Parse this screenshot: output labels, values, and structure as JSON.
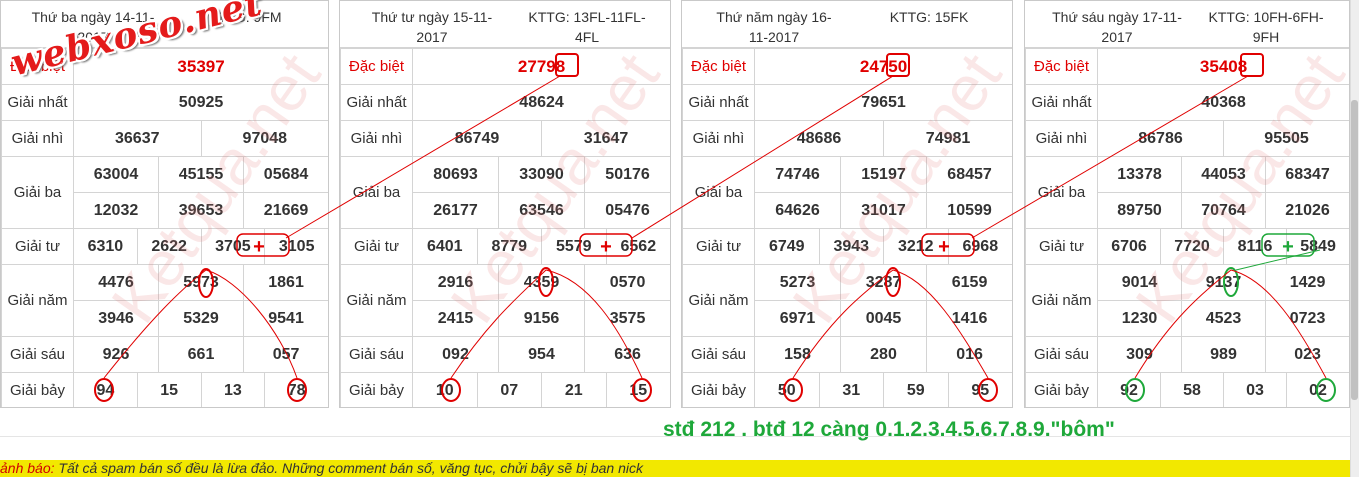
{
  "panels": [
    {
      "date_line1": "Thứ ba ngày 14-11-",
      "date_line2": "2017",
      "kttg_line1": "KTTG: 9FM",
      "kttg_line2": "",
      "dac_biet": "35397",
      "giai_nhat": "50925",
      "giai_nhi": [
        "36637",
        "97048"
      ],
      "giai_ba": [
        "63004",
        "45155",
        "05684",
        "12032",
        "39653",
        "21669"
      ],
      "giai_tu": [
        "6310",
        "2622",
        "3705",
        "3105"
      ],
      "giai_nam": [
        "4476",
        "5973",
        "1861",
        "3946",
        "5329",
        "9541"
      ],
      "giai_sau": [
        "926",
        "661",
        "057"
      ],
      "giai_bay": [
        "94",
        "15",
        "13",
        "78"
      ]
    },
    {
      "date_line1": "Thứ tư ngày 15-11-",
      "date_line2": "2017",
      "kttg_line1": "KTTG: 13FL-11FL-",
      "kttg_line2": "4FL",
      "dac_biet": "27798",
      "giai_nhat": "48624",
      "giai_nhi": [
        "86749",
        "31647"
      ],
      "giai_ba": [
        "80693",
        "33090",
        "50176",
        "26177",
        "63546",
        "05476"
      ],
      "giai_tu": [
        "6401",
        "8779",
        "5579",
        "6562"
      ],
      "giai_nam": [
        "2916",
        "4359",
        "0570",
        "2415",
        "9156",
        "3575"
      ],
      "giai_sau": [
        "092",
        "954",
        "636"
      ],
      "giai_bay": [
        "10",
        "07",
        "21",
        "15"
      ]
    },
    {
      "date_line1": "Thứ năm ngày 16-",
      "date_line2": "11-2017",
      "kttg_line1": "KTTG: 15FK",
      "kttg_line2": "",
      "dac_biet": "24750",
      "giai_nhat": "79651",
      "giai_nhi": [
        "48686",
        "74981"
      ],
      "giai_ba": [
        "74746",
        "15197",
        "68457",
        "64626",
        "31017",
        "10599"
      ],
      "giai_tu": [
        "6749",
        "3943",
        "3212",
        "6968"
      ],
      "giai_nam": [
        "5273",
        "3287",
        "6159",
        "6971",
        "0045",
        "1416"
      ],
      "giai_sau": [
        "158",
        "280",
        "016"
      ],
      "giai_bay": [
        "50",
        "31",
        "59",
        "95"
      ]
    },
    {
      "date_line1": "Thứ sáu ngày 17-11-",
      "date_line2": "2017",
      "kttg_line1": "KTTG: 10FH-6FH-",
      "kttg_line2": "9FH",
      "dac_biet": "35408",
      "giai_nhat": "40368",
      "giai_nhi": [
        "86786",
        "95505"
      ],
      "giai_ba": [
        "13378",
        "44053",
        "68347",
        "89750",
        "70764",
        "21026"
      ],
      "giai_tu": [
        "6706",
        "7720",
        "8116",
        "5849"
      ],
      "giai_nam": [
        "9014",
        "9137",
        "1429",
        "1230",
        "4523",
        "0723"
      ],
      "giai_sau": [
        "309",
        "989",
        "023"
      ],
      "giai_bay": [
        "92",
        "58",
        "03",
        "02"
      ]
    }
  ],
  "labels": {
    "dac_biet": "Đặc biệt",
    "giai_nhat": "Giải nhất",
    "giai_nhi": "Giải nhì",
    "giai_ba": "Giải ba",
    "giai_tu": "Giải tư",
    "giai_nam": "Giải năm",
    "giai_sau": "Giải sáu",
    "giai_bay": "Giải bảy"
  },
  "watermark_logo": "webxoso.net",
  "watermark_bg": "Ketqua.net",
  "comment": "stđ 212 . btđ 12 càng 0.1.2.3.4.5.6.7.8.9.\"bôm\"",
  "warning": {
    "label": "ảnh báo:",
    "text": " Tất cả spam bán số đều là lừa đảo. Những comment bán số, văng tục, chửi bậy sẽ bị ban nick"
  },
  "plus_glyph": "+",
  "colors": {
    "red": "#e00000",
    "green": "#1ea83a",
    "warning_bg": "#f2e800"
  }
}
